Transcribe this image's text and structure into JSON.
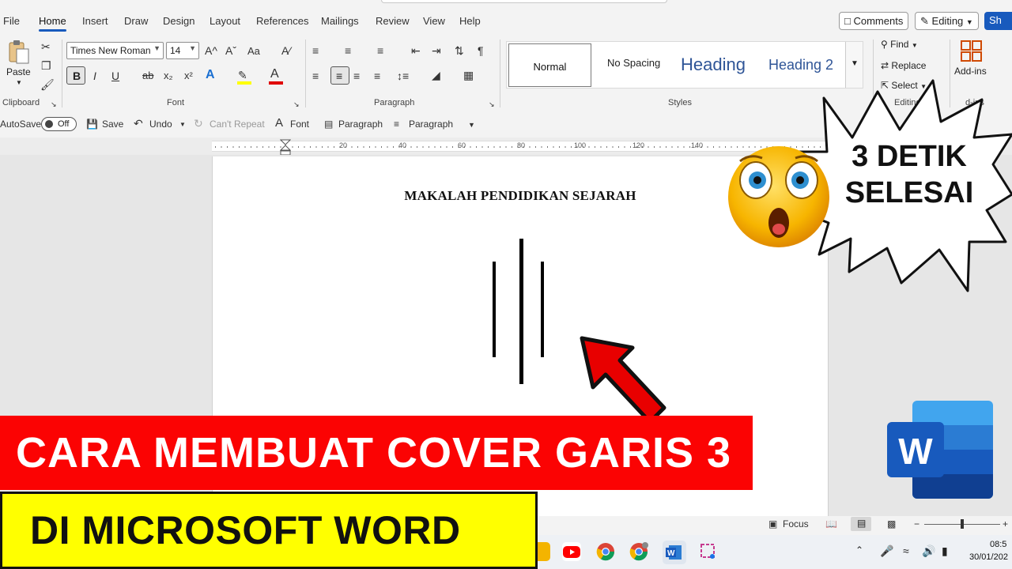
{
  "menu": {
    "items": [
      "File",
      "Home",
      "Insert",
      "Draw",
      "Design",
      "Layout",
      "References",
      "Mailings",
      "Review",
      "View",
      "Help"
    ],
    "active": "Home",
    "comments_label": "Comments",
    "editing_label": "Editing",
    "share_label": "Sh"
  },
  "ribbon": {
    "paste_label": "Paste",
    "clipboard_label": "Clipboard",
    "font_name": "Times New Roman",
    "font_size": "14",
    "font_label": "Font",
    "paragraph_label": "Paragraph",
    "styles_label": "Styles",
    "styles": [
      "Normal",
      "No Spacing",
      "Heading",
      "Heading 2"
    ],
    "find_label": "Find",
    "replace_label": "Replace",
    "select_label": "Select",
    "editing_group_label": "Editing",
    "addins_label": "Add-ins",
    "addins_group_label": "d-ins",
    "bold": "B",
    "italic": "I",
    "underline": "U",
    "strike": "ab",
    "sub": "x₂",
    "sup": "x²",
    "grow": "A^",
    "shrink": "Aˇ",
    "case": "Aa"
  },
  "qat": {
    "autosave_label": "AutoSave",
    "autosave_state": "Off",
    "save_label": "Save",
    "undo_label": "Undo",
    "repeat_label": "Can't Repeat",
    "font_label": "Font",
    "paragraph_label_1": "Paragraph",
    "paragraph_label_2": "Paragraph"
  },
  "ruler": {
    "marks": [
      "20",
      "40",
      "60",
      "80",
      "100",
      "120",
      "140"
    ]
  },
  "document": {
    "title": "MAKALAH PENDIDIKAN SEJARAH"
  },
  "status": {
    "focus_label": "Focus"
  },
  "taskbar": {
    "time": "08:5",
    "date": "30/01/202"
  },
  "overlay": {
    "burst_text_line1": "3 DETIK",
    "burst_text_line2": "SELESAI",
    "banner_red": "CARA MEMBUAT COVER GARIS 3",
    "banner_yellow": "DI MICROSOFT WORD",
    "word_logo_letter": "W"
  },
  "colors": {
    "accent": "#185abd",
    "banner_red": "#fb0303",
    "banner_yellow": "#ffff00",
    "arrow": "#e80000"
  }
}
